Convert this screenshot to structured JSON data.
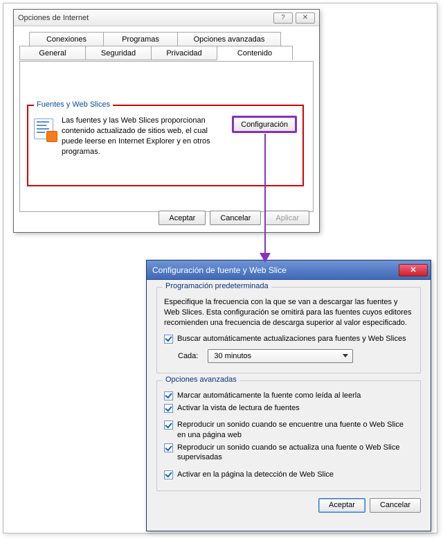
{
  "dialog1": {
    "title": "Opciones de Internet",
    "help_glyph": "?",
    "close_glyph": "✕",
    "tabs_row1": [
      "Conexiones",
      "Programas",
      "Opciones avanzadas"
    ],
    "tabs_row2": [
      "General",
      "Seguridad",
      "Privacidad",
      "Contenido"
    ],
    "fieldset": {
      "legend": "Fuentes y Web Slices",
      "desc": "Las fuentes y las Web Slices proporcionan contenido actualizado de sitios web, el cual puede leerse en Internet Explorer y en otros programas.",
      "config_btn": "Configuración"
    },
    "buttons": {
      "ok": "Aceptar",
      "cancel": "Cancelar",
      "apply": "Aplicar"
    }
  },
  "dialog2": {
    "title": "Configuración de fuente y Web Slice",
    "close_glyph": "✕",
    "group1": {
      "legend": "Programación predeterminada",
      "desc": "Especifique la frecuencia con la que se van a descargar las fuentes y Web Slices. Esta configuración se omitirá para las fuentes cuyos editores recomienden una frecuencia de descarga superior al valor especificado.",
      "chk_auto": "Buscar automáticamente actualizaciones para fuentes y Web Slices",
      "cada_label": "Cada:",
      "interval": "30 minutos"
    },
    "group2": {
      "legend": "Opciones avanzadas",
      "chk1": "Marcar automáticamente la fuente como leída al leerla",
      "chk2": "Activar la vista de lectura de fuentes",
      "chk3": "Reproducir un sonido cuando se encuentre una fuente o Web Slice en una página web",
      "chk4": "Reproducir un sonido cuando se actualiza una fuente o Web Slice supervisadas",
      "chk5": "Activar en la página la detección de Web Slice"
    },
    "buttons": {
      "ok": "Aceptar",
      "cancel": "Cancelar"
    }
  }
}
